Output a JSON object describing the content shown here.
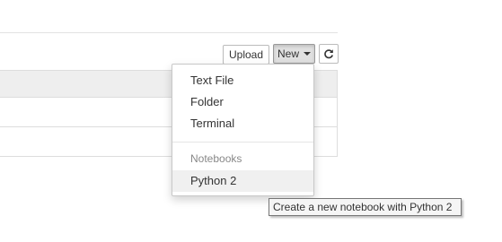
{
  "toolbar": {
    "upload_label": "Upload",
    "new_label": "New",
    "refresh_icon": "refresh-icon"
  },
  "new_menu": {
    "items": [
      {
        "label": "Text File"
      },
      {
        "label": "Folder"
      },
      {
        "label": "Terminal"
      }
    ],
    "notebooks_header": "Notebooks",
    "kernels": [
      {
        "label": "Python 2"
      }
    ]
  },
  "tooltip": {
    "text": "Create a new notebook with Python 2"
  }
}
